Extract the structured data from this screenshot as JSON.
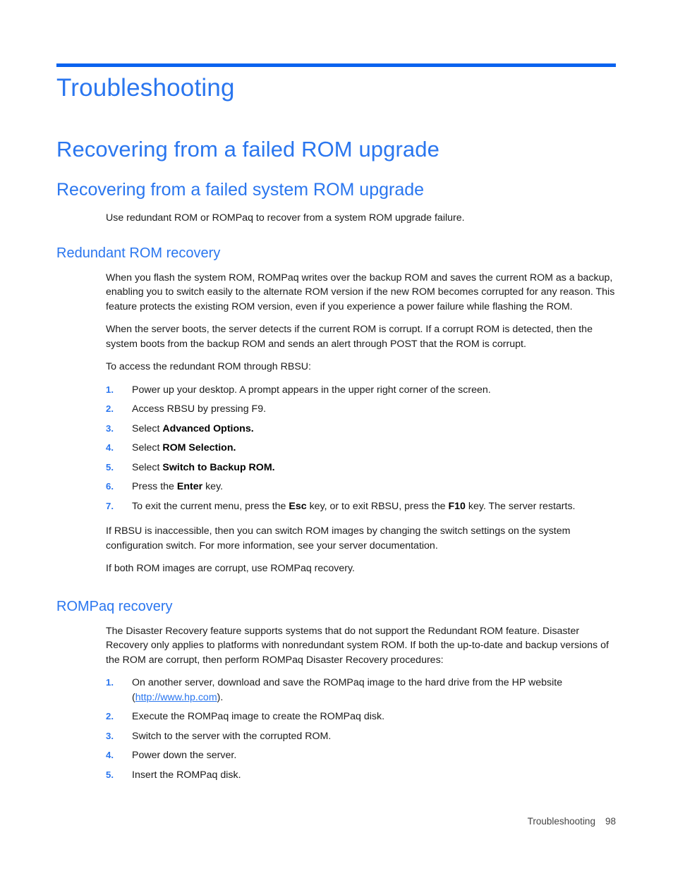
{
  "theme": {
    "accent_blue": "#2a76ef",
    "rule_blue": "#0a63ef",
    "body_text": "#1a1a1a"
  },
  "chapter": {
    "title": "Troubleshooting"
  },
  "sections": {
    "h2_recovering_failed_rom": "Recovering from a failed ROM upgrade",
    "h3_recovering_failed_system_rom": "Recovering from a failed system ROM upgrade",
    "h4_redundant_rom_recovery": "Redundant ROM recovery",
    "h4_rompaq_recovery": "ROMPaq recovery"
  },
  "paragraphs": {
    "intro": "Use redundant ROM or ROMPaq to recover from a system ROM upgrade failure.",
    "redundant_p1": "When you flash the system ROM, ROMPaq writes over the backup ROM and saves the current ROM as a backup, enabling you to switch easily to the alternate ROM version if the new ROM becomes corrupted for any reason. This feature protects the existing ROM version, even if you experience a power failure while flashing the ROM.",
    "redundant_p2": "When the server boots, the server detects if the current ROM is corrupt. If a corrupt ROM is detected, then the system boots from the backup ROM and sends an alert through POST that the ROM is corrupt.",
    "redundant_p3": "To access the redundant ROM through RBSU:",
    "redundant_p4": "If RBSU is inaccessible, then you can switch ROM images by changing the switch settings on the system configuration switch. For more information, see your server documentation.",
    "redundant_p5": "If both ROM images are corrupt, use ROMPaq recovery.",
    "rompaq_p1": "The Disaster Recovery feature supports systems that do not support the Redundant ROM feature. Disaster Recovery only applies to platforms with nonredundant system ROM. If both the up-to-date and backup versions of the ROM are corrupt, then perform ROMPaq Disaster Recovery procedures:"
  },
  "rbsu_steps": [
    {
      "num": "1.",
      "pre": "Power up your desktop. A prompt appears in the upper right corner of the screen.",
      "bold": "",
      "post": ""
    },
    {
      "num": "2.",
      "pre": "Access RBSU by pressing F9.",
      "bold": "",
      "post": ""
    },
    {
      "num": "3.",
      "pre": "Select ",
      "bold": "Advanced Options.",
      "post": ""
    },
    {
      "num": "4.",
      "pre": "Select ",
      "bold": "ROM Selection.",
      "post": ""
    },
    {
      "num": "5.",
      "pre": "Select ",
      "bold": "Switch to Backup ROM.",
      "post": ""
    },
    {
      "num": "6.",
      "pre": "Press the ",
      "bold": "Enter",
      "post": " key."
    },
    {
      "num": "7.",
      "pre": "To exit the current menu, press the ",
      "bold": "Esc",
      "post": " key, or to exit RBSU, press the ",
      "bold2": "F10",
      "post2": " key. The server restarts."
    }
  ],
  "rompaq_steps": [
    {
      "num": "1.",
      "pre": "On another server, download and save the ROMPaq image to the hard drive from the HP website (",
      "link": "http://www.hp.com",
      "post": ")."
    },
    {
      "num": "2.",
      "pre": "Execute the ROMPaq image to create the ROMPaq disk.",
      "link": "",
      "post": ""
    },
    {
      "num": "3.",
      "pre": "Switch to the server with the corrupted ROM.",
      "link": "",
      "post": ""
    },
    {
      "num": "4.",
      "pre": "Power down the server.",
      "link": "",
      "post": ""
    },
    {
      "num": "5.",
      "pre": "Insert the ROMPaq disk.",
      "link": "",
      "post": ""
    }
  ],
  "footer": {
    "label": "Troubleshooting",
    "page_number": "98"
  }
}
